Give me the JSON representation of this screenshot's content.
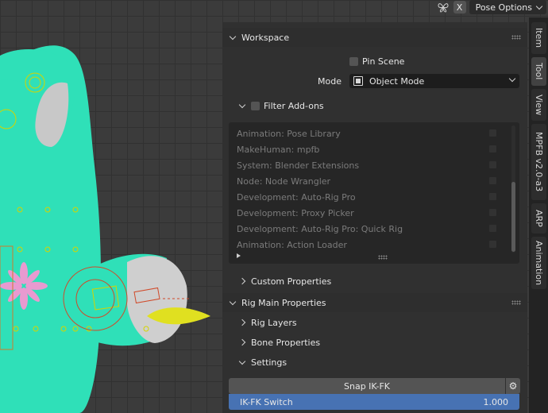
{
  "header": {
    "close_label": "X",
    "pose_options_label": "Pose Options"
  },
  "workspace": {
    "title": "Workspace",
    "pin_scene_label": "Pin Scene",
    "mode_label": "Mode",
    "mode_value": "Object Mode",
    "filter_addons_label": "Filter Add-ons",
    "addons": [
      "Animation: Pose Library",
      "MakeHuman: mpfb",
      "System: Blender Extensions",
      "Node: Node Wrangler",
      "Development: Auto-Rig Pro",
      "Development: Proxy Picker",
      "Development: Auto-Rig Pro: Quick Rig",
      "Animation: Action Loader"
    ]
  },
  "custom_properties": {
    "title": "Custom Properties"
  },
  "rig_main": {
    "title": "Rig Main Properties",
    "rig_layers_label": "Rig Layers",
    "bone_properties_label": "Bone Properties",
    "settings_label": "Settings",
    "snap_label": "Snap IK-FK",
    "ikfk_label": "IK-FK Switch",
    "ikfk_value": "1.000"
  },
  "tabs": [
    "Item",
    "Tool",
    "View",
    "MPFB v2.0-a3",
    "ARP",
    "Animation"
  ],
  "colors": {
    "mesh": "#2fe0b8",
    "panel": "#303030",
    "accent": "#4772b3",
    "beak": "#e0e020"
  }
}
